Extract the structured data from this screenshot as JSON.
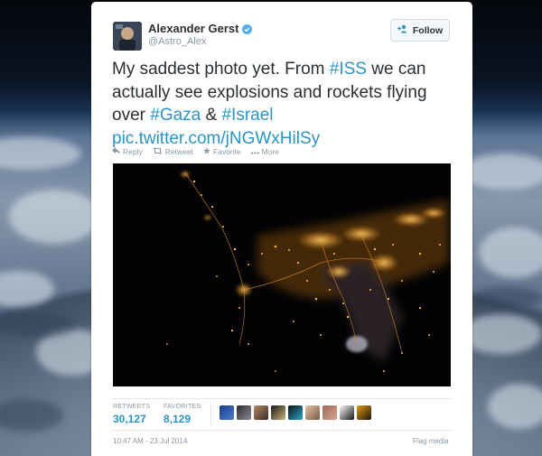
{
  "tweet": {
    "author_name": "Alexander Gerst",
    "handle": "@Astro_Alex",
    "follow_label": "Follow",
    "text": {
      "part1": "My saddest photo yet. From ",
      "tag_iss": "#ISS",
      "part2": " we can actually see explosions and rockets flying over ",
      "tag_gaza": "#Gaza",
      "part3": " & ",
      "tag_israel": "#Israel",
      "link": "pic.twitter.com/jNGWxHilSy"
    },
    "actions": {
      "reply": "Reply",
      "retweet": "Retweet",
      "favorite": "Favorite",
      "more": "More"
    },
    "stats": {
      "retweets_label": "RETWEETS",
      "retweets_value": "30,127",
      "favorites_label": "FAVORITES",
      "favorites_value": "8,129"
    },
    "timestamp": "10:47 AM - 23 Jul 2014",
    "flag_label": "Flag media"
  },
  "icons": {
    "verified": "verified-badge-icon",
    "follow": "add-person-icon",
    "reply": "reply-arrow-icon",
    "retweet": "retweet-icon",
    "favorite": "star-icon",
    "more": "ellipsis-icon"
  },
  "colors": {
    "link_blue": "#2b94c7",
    "text_dark": "#292f33",
    "muted_gray": "#8899a6",
    "verified_blue": "#55acee"
  }
}
